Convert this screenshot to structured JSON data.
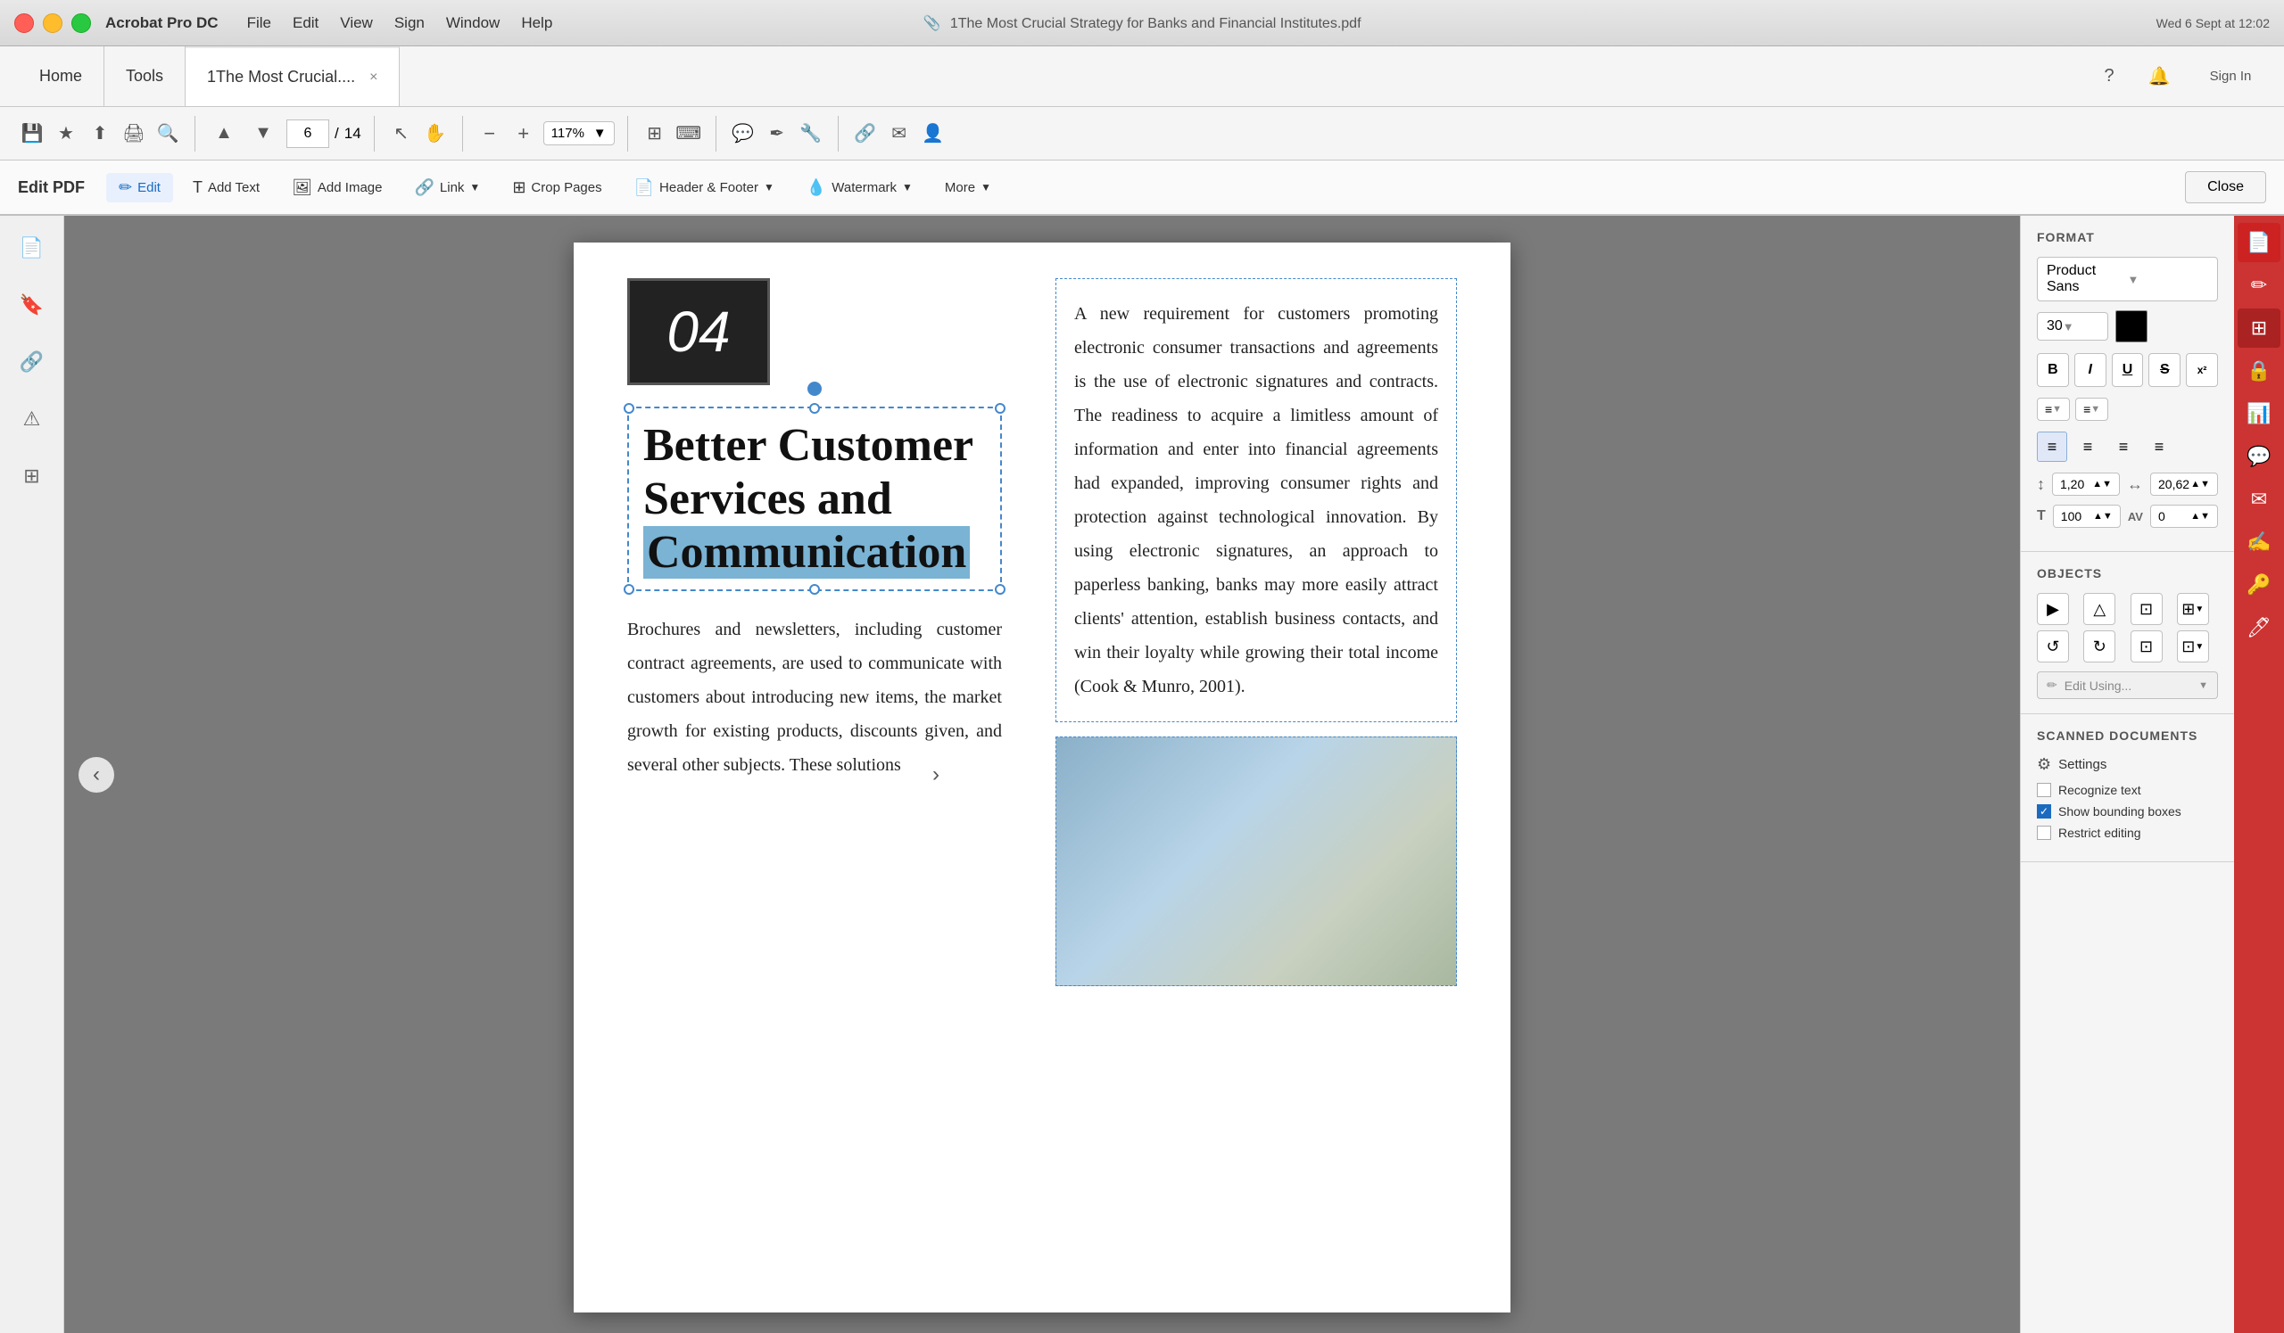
{
  "mac": {
    "app_name": "Acrobat Pro DC",
    "menu_items": [
      "File",
      "Edit",
      "View",
      "Sign",
      "Window",
      "Help"
    ],
    "file_title": "1The Most Crucial Strategy for Banks and Financial Institutes.pdf",
    "datetime": "Wed 6 Sept at  12:02",
    "traffic_lights": [
      "close",
      "minimize",
      "maximize"
    ]
  },
  "toolbar": {
    "home_label": "Home",
    "tools_label": "Tools",
    "doc_tab_label": "1The Most Crucial....",
    "close_tab": "×",
    "question_mark": "?",
    "notification_bell": "🔔",
    "sign_in": "Sign In",
    "icons": [
      "💾",
      "★",
      "⬆",
      "🖨",
      "🔍"
    ]
  },
  "nav_toolbar": {
    "prev": "▲",
    "next": "▼",
    "page_current": "6",
    "page_sep": "/",
    "page_total": "14",
    "pointer_icon": "↖",
    "hand_icon": "✋",
    "zoom_out": "−",
    "zoom_in": "+",
    "zoom_level": "117%",
    "crop_icon": "⊞",
    "edit_icon": "✏",
    "comment_icon": "💬",
    "pen_icon": "✒",
    "tools_icon": "🔧",
    "link_icon": "🔗",
    "mail_icon": "✉",
    "person_icon": "👤"
  },
  "edit_toolbar": {
    "title": "Edit PDF",
    "edit_label": "Edit",
    "add_text_label": "Add Text",
    "add_image_label": "Add Image",
    "link_label": "Link",
    "crop_label": "Crop Pages",
    "header_footer_label": "Header & Footer",
    "watermark_label": "Watermark",
    "more_label": "More",
    "close_label": "Close"
  },
  "left_sidebar": {
    "icons": [
      "📄",
      "🔖",
      "🔗",
      "⚠",
      "⊞"
    ]
  },
  "pdf": {
    "page_number": "04",
    "heading_line1": "Better Customer",
    "heading_line2": "Services and",
    "heading_line3_highlight": "Communication",
    "body_text": "Brochures and newsletters, including customer contract agreements, are used to communicate with customers about introducing new items, the market growth for existing products, discounts given, and several other subjects. These solutions",
    "right_column_text": "A new requirement for customers promoting electronic consumer transactions and agreements is the use of electronic signatures and contracts. The readiness to acquire a limitless amount of information and enter into financial agreements had expanded, improving consumer rights and protection against technological innovation. By using electronic signatures, an approach to paperless banking, banks may more easily attract clients' attention, establish business contacts, and win their loyalty while growing their total income (Cook & Munro, 2001)."
  },
  "format_panel": {
    "title": "FORMAT",
    "font_name": "Product Sans",
    "font_size": "30",
    "font_size_arrow": "▼",
    "font_dropdown_arrow": "▼",
    "styles": [
      "B",
      "I",
      "U",
      "S",
      "X"
    ],
    "list_types": [
      "≡",
      "≡"
    ],
    "align": [
      "≡",
      "≡",
      "≡",
      "≡"
    ],
    "spacing_line": "1,20",
    "spacing_char": "20,62",
    "size_t_label": "T",
    "size_av_label": "AV",
    "size_av_value": "0",
    "size_percent": "100"
  },
  "objects_panel": {
    "title": "OBJECTS",
    "edit_using_label": "Edit Using...",
    "edit_icon": "✏"
  },
  "scanned_panel": {
    "title": "SCANNED DOCUMENTS",
    "settings_label": "Settings",
    "recognize_text_label": "Recognize text",
    "show_bounding_boxes_label": "Show bounding boxes",
    "restrict_editing_label": "Restrict editing",
    "show_bounding_checked": true,
    "recognize_checked": false,
    "restrict_checked": false
  },
  "right_strip": {
    "icons": [
      "📄",
      "✏",
      "⊞",
      "🔒",
      "📊",
      "📎",
      "✉",
      "👤",
      "🔑",
      "🖊"
    ]
  }
}
